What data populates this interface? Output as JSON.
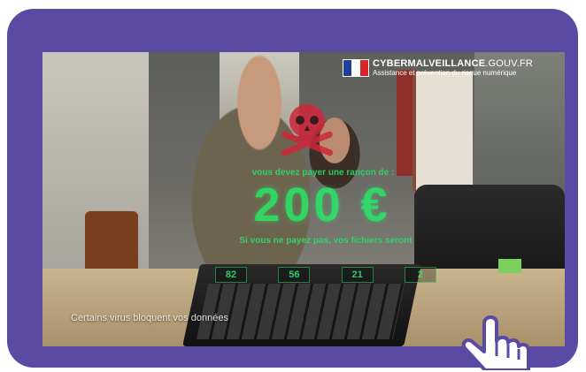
{
  "logo": {
    "title_bold": "CYBERMALVEILLANCE",
    "title_suffix": ".GOUV.FR",
    "subtitle": "Assistance et prévention du risque numérique"
  },
  "ransom": {
    "top_text": "vous devez payer une rançon de :",
    "amount": "200 €",
    "bottom_text": "Si vous ne payez pas, vos fichiers seront",
    "countdown": [
      "82",
      "56",
      "21",
      "2"
    ]
  },
  "caption": "Certains virus bloquent vos données",
  "colors": {
    "frame": "#5b4aa3",
    "ransom_green": "#29e868",
    "skull_red": "#d0263a"
  },
  "icons": {
    "skull": "skull-icon",
    "flag": "french-flag-icon",
    "cursor": "hand-pointer-icon"
  }
}
